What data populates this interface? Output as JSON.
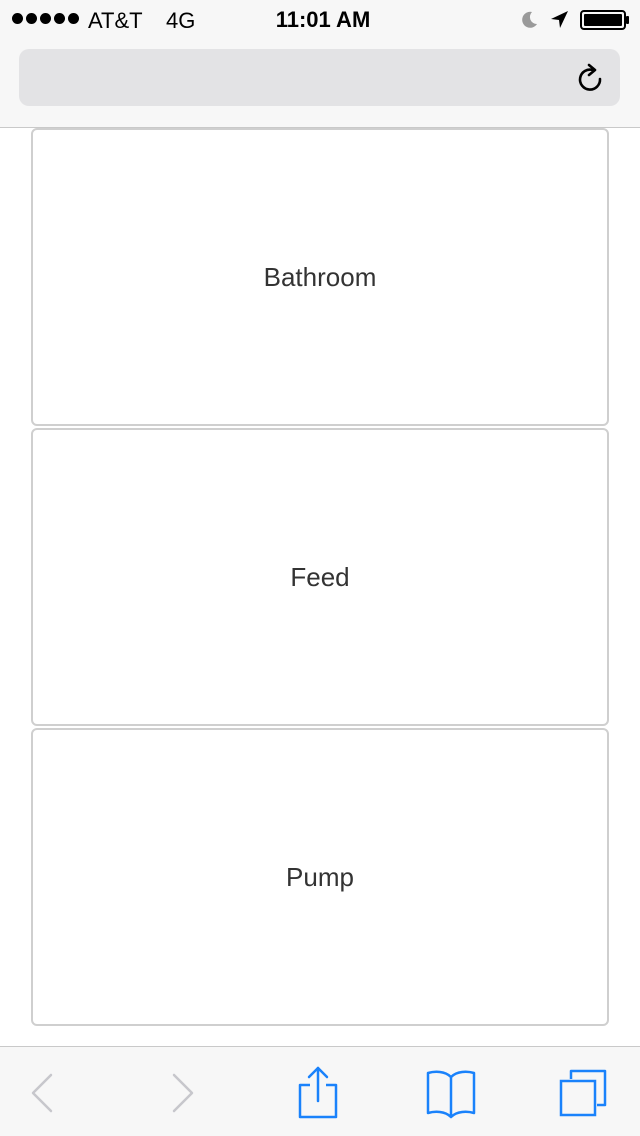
{
  "status_bar": {
    "carrier": "AT&T",
    "network": "4G",
    "time": "11:01 AM"
  },
  "address_bar": {
    "url": ""
  },
  "tiles": [
    {
      "label": "Bathroom"
    },
    {
      "label": "Feed"
    },
    {
      "label": "Pump"
    }
  ],
  "colors": {
    "ios_blue": "#1a82fb",
    "disabled_gray": "#c7c7cc",
    "tile_border": "#cfcfcf"
  },
  "icons": {
    "toolbar": [
      "back-icon",
      "forward-icon",
      "share-icon",
      "bookmarks-icon",
      "tabs-icon"
    ],
    "status": [
      "signal-icon",
      "moon-icon",
      "location-icon",
      "battery-icon"
    ],
    "address": [
      "reload-icon"
    ]
  }
}
